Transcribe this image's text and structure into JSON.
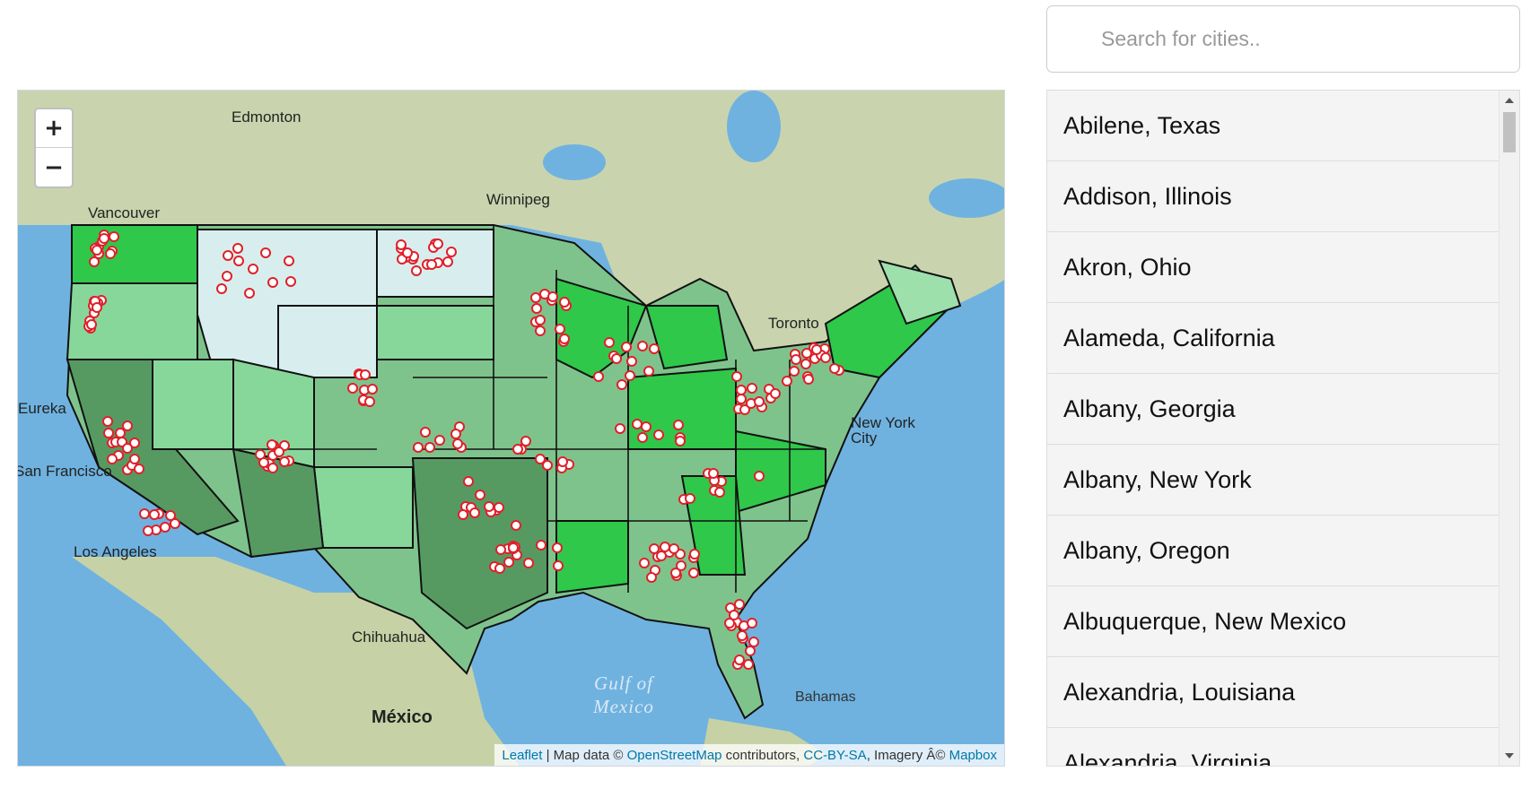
{
  "search": {
    "placeholder": "Search for cities.."
  },
  "map": {
    "zoom_in_label": "+",
    "zoom_out_label": "−",
    "place_labels": [
      "Edmonton",
      "Vancouver",
      "Winnipeg",
      "Eureka",
      "San Francisco",
      "Los Angeles",
      "Chihuahua",
      "México",
      "Toronto",
      "New York City",
      "Bahamas",
      "Gulf of Mexico"
    ],
    "attribution": {
      "leaflet": "Leaflet",
      "sep1": " | Map data © ",
      "osm": "OpenStreetMap",
      "contrib": " contributors, ",
      "license": "CC-BY-SA",
      "imagery": ", Imagery Â© ",
      "mapbox": "Mapbox"
    },
    "colors": {
      "water": "#6fb2e0",
      "land": "#cfd9b4",
      "state_bright": "#29c844",
      "state_dark": "#5f9d6c",
      "marker": "#e0202a"
    }
  },
  "cities": [
    "Abilene, Texas",
    "Addison, Illinois",
    "Akron, Ohio",
    "Alameda, California",
    "Albany, Georgia",
    "Albany, New York",
    "Albany, Oregon",
    "Albuquerque, New Mexico",
    "Alexandria, Louisiana",
    "Alexandria, Virginia"
  ]
}
